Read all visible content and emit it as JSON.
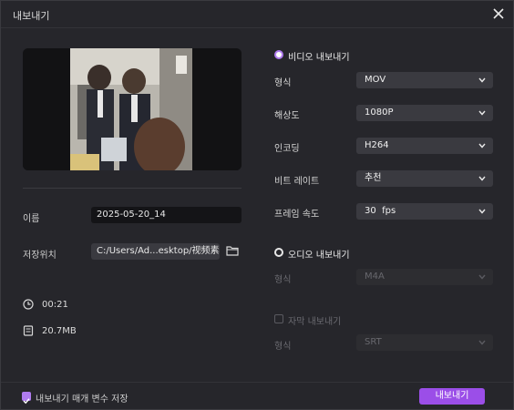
{
  "window": {
    "title": "내보내기"
  },
  "left": {
    "name_label": "이름",
    "name_value": "2025-05-20_14",
    "path_label": "저장위치",
    "path_value": "C:/Users/Ad...esktop/视频素材",
    "duration": "00:21",
    "size": "20.7MB"
  },
  "video": {
    "title": "비디오 내보내기",
    "rows": [
      {
        "label": "형식",
        "value": "MOV"
      },
      {
        "label": "해상도",
        "value": "1080P"
      },
      {
        "label": "인코딩",
        "value": "H264"
      },
      {
        "label": "비트 레이트",
        "value": "추천"
      },
      {
        "label": "프레임 속도",
        "value": "30  fps"
      }
    ]
  },
  "audio": {
    "title": "오디오 내보내기",
    "format_label": "형식",
    "format_value": "M4A"
  },
  "subtitle": {
    "title": "자막 내보내기",
    "format_label": "형식",
    "format_value": "SRT"
  },
  "footer": {
    "remember_label": "내보내기 매개 변수 저장",
    "export_label": "내보내기"
  },
  "colors": {
    "accent": "#9b4ee8",
    "radio_on": "#b07cf0",
    "background": "#26262b"
  }
}
